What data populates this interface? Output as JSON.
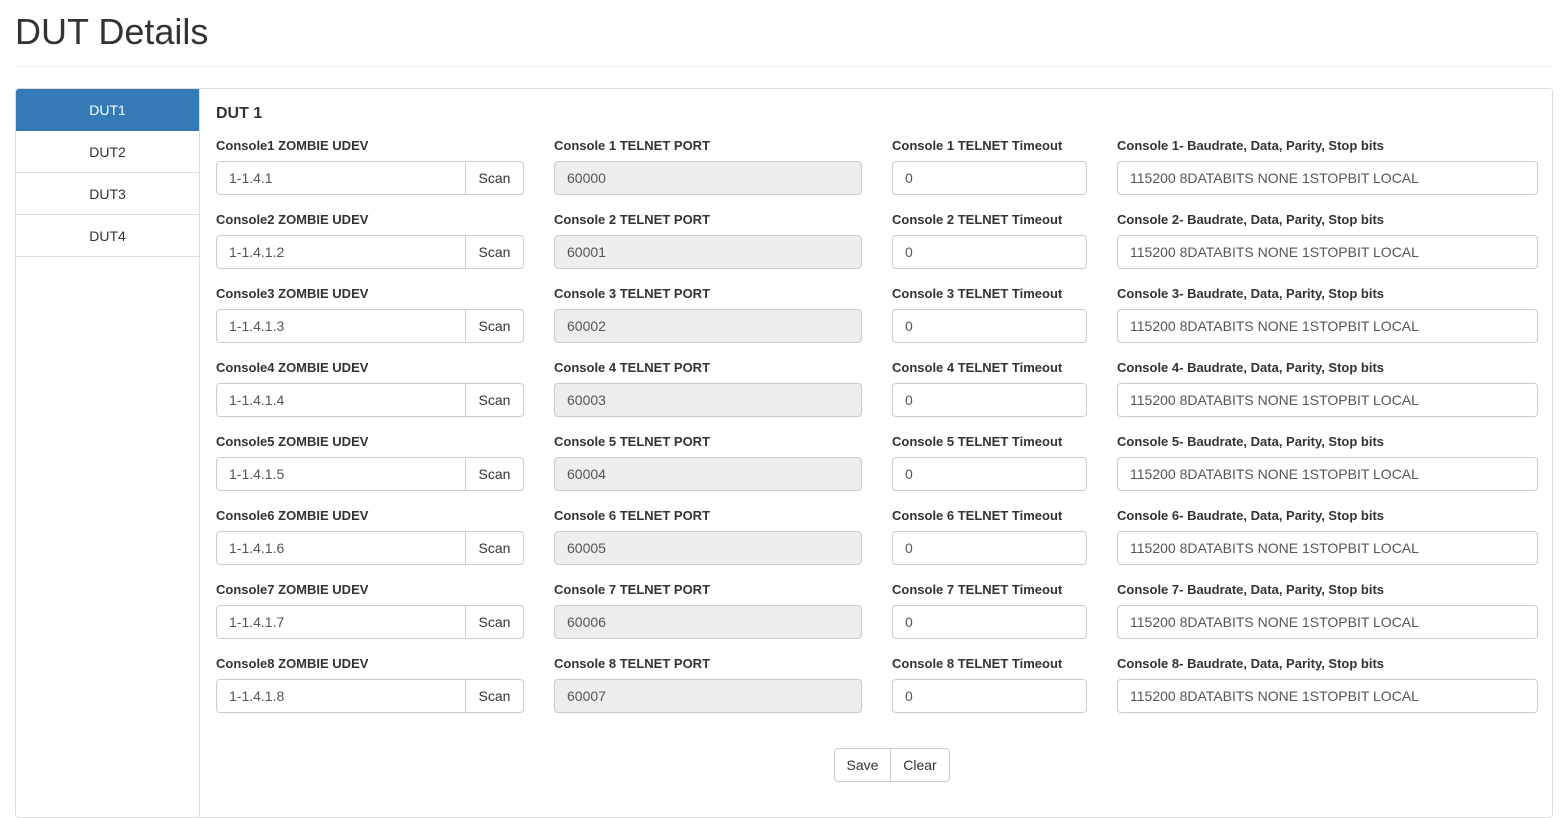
{
  "page": {
    "title": "DUT Details"
  },
  "sidebar": {
    "items": [
      {
        "label": "DUT1",
        "active": true
      },
      {
        "label": "DUT2",
        "active": false
      },
      {
        "label": "DUT3",
        "active": false
      },
      {
        "label": "DUT4",
        "active": false
      }
    ]
  },
  "form": {
    "title": "DUT 1",
    "scan_label": "Scan",
    "consoles": [
      {
        "udev_label": "Console1 ZOMBIE UDEV",
        "udev_value": "1-1.4.1",
        "port_label": "Console 1 TELNET PORT",
        "port_value": "60000",
        "timeout_label": "Console 1 TELNET Timeout",
        "timeout_value": "0",
        "baud_label": "Console 1- Baudrate, Data, Parity, Stop bits",
        "baud_value": "115200 8DATABITS NONE 1STOPBIT LOCAL"
      },
      {
        "udev_label": "Console2 ZOMBIE UDEV",
        "udev_value": "1-1.4.1.2",
        "port_label": "Console 2 TELNET PORT",
        "port_value": "60001",
        "timeout_label": "Console 2 TELNET Timeout",
        "timeout_value": "0",
        "baud_label": "Console 2- Baudrate, Data, Parity, Stop bits",
        "baud_value": "115200 8DATABITS NONE 1STOPBIT LOCAL"
      },
      {
        "udev_label": "Console3 ZOMBIE UDEV",
        "udev_value": "1-1.4.1.3",
        "port_label": "Console 3 TELNET PORT",
        "port_value": "60002",
        "timeout_label": "Console 3 TELNET Timeout",
        "timeout_value": "0",
        "baud_label": "Console 3- Baudrate, Data, Parity, Stop bits",
        "baud_value": "115200 8DATABITS NONE 1STOPBIT LOCAL"
      },
      {
        "udev_label": "Console4 ZOMBIE UDEV",
        "udev_value": "1-1.4.1.4",
        "port_label": "Console 4 TELNET PORT",
        "port_value": "60003",
        "timeout_label": "Console 4 TELNET Timeout",
        "timeout_value": "0",
        "baud_label": "Console 4- Baudrate, Data, Parity, Stop bits",
        "baud_value": "115200 8DATABITS NONE 1STOPBIT LOCAL"
      },
      {
        "udev_label": "Console5 ZOMBIE UDEV",
        "udev_value": "1-1.4.1.5",
        "port_label": "Console 5 TELNET PORT",
        "port_value": "60004",
        "timeout_label": "Console 5 TELNET Timeout",
        "timeout_value": "0",
        "baud_label": "Console 5- Baudrate, Data, Parity, Stop bits",
        "baud_value": "115200 8DATABITS NONE 1STOPBIT LOCAL"
      },
      {
        "udev_label": "Console6 ZOMBIE UDEV",
        "udev_value": "1-1.4.1.6",
        "port_label": "Console 6 TELNET PORT",
        "port_value": "60005",
        "timeout_label": "Console 6 TELNET Timeout",
        "timeout_value": "0",
        "baud_label": "Console 6- Baudrate, Data, Parity, Stop bits",
        "baud_value": "115200 8DATABITS NONE 1STOPBIT LOCAL"
      },
      {
        "udev_label": "Console7 ZOMBIE UDEV",
        "udev_value": "1-1.4.1.7",
        "port_label": "Console 7 TELNET PORT",
        "port_value": "60006",
        "timeout_label": "Console 7 TELNET Timeout",
        "timeout_value": "0",
        "baud_label": "Console 7- Baudrate, Data, Parity, Stop bits",
        "baud_value": "115200 8DATABITS NONE 1STOPBIT LOCAL"
      },
      {
        "udev_label": "Console8 ZOMBIE UDEV",
        "udev_value": "1-1.4.1.8",
        "port_label": "Console 8 TELNET PORT",
        "port_value": "60007",
        "timeout_label": "Console 8 TELNET Timeout",
        "timeout_value": "0",
        "baud_label": "Console 8- Baudrate, Data, Parity, Stop bits",
        "baud_value": "115200 8DATABITS NONE 1STOPBIT LOCAL"
      }
    ],
    "save_label": "Save",
    "clear_label": "Clear"
  },
  "colors": {
    "accent": "#337ab7",
    "readonly_bg": "#eeeeee",
    "border": "#cccccc"
  }
}
